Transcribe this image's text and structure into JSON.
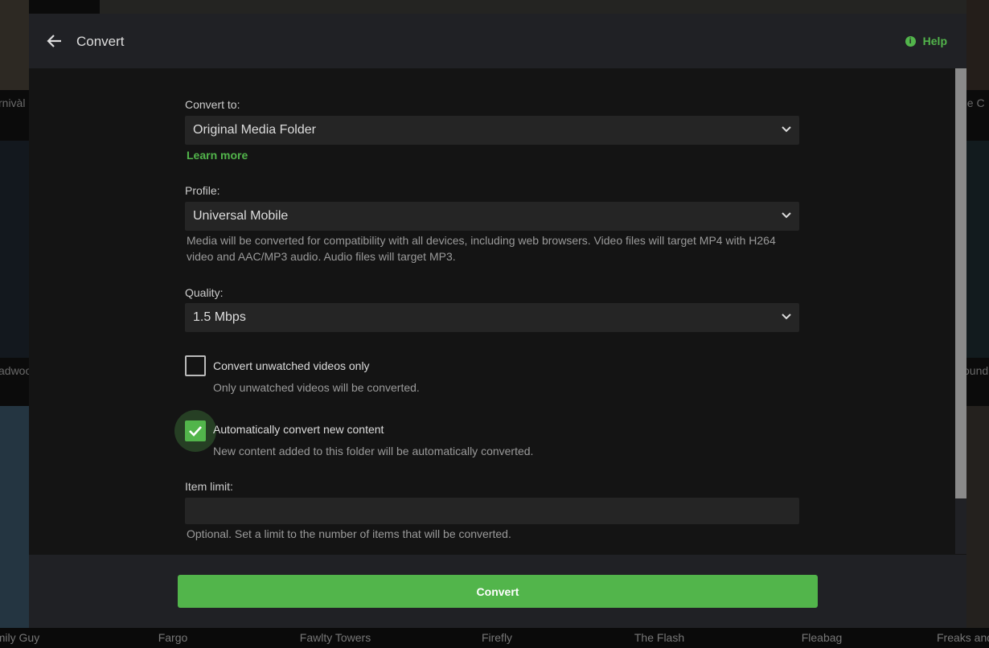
{
  "background": {
    "labels": [
      "rnivàl",
      "adwoo",
      "he C",
      "ound"
    ],
    "bottom_titles": [
      "mily Guy",
      "Fargo",
      "Fawlty Towers",
      "Firefly",
      "The Flash",
      "Fleabag",
      "Freaks and"
    ]
  },
  "header": {
    "title": "Convert",
    "help_label": "Help",
    "back_icon": "arrow-left-icon",
    "help_icon": "info-icon"
  },
  "form": {
    "convert_to": {
      "label": "Convert to:",
      "value": "Original Media Folder",
      "learn_more": "Learn more"
    },
    "profile": {
      "label": "Profile:",
      "value": "Universal Mobile",
      "description": "Media will be converted for compatibility with all devices, including web browsers. Video files will target MP4 with H264 video and AAC/MP3 audio. Audio files will target MP3."
    },
    "quality": {
      "label": "Quality:",
      "value": "1.5 Mbps"
    },
    "unwatched": {
      "label": "Convert unwatched videos only",
      "description": "Only unwatched videos will be converted.",
      "checked": false
    },
    "auto": {
      "label": "Automatically convert new content",
      "description": "New content added to this folder will be automatically converted.",
      "checked": true
    },
    "item_limit": {
      "label": "Item limit:",
      "value": "",
      "description": "Optional. Set a limit to the number of items that will be converted."
    }
  },
  "footer": {
    "convert_label": "Convert"
  },
  "colors": {
    "accent": "#52b54b",
    "header_bg": "#202125",
    "body_bg": "#141414"
  }
}
